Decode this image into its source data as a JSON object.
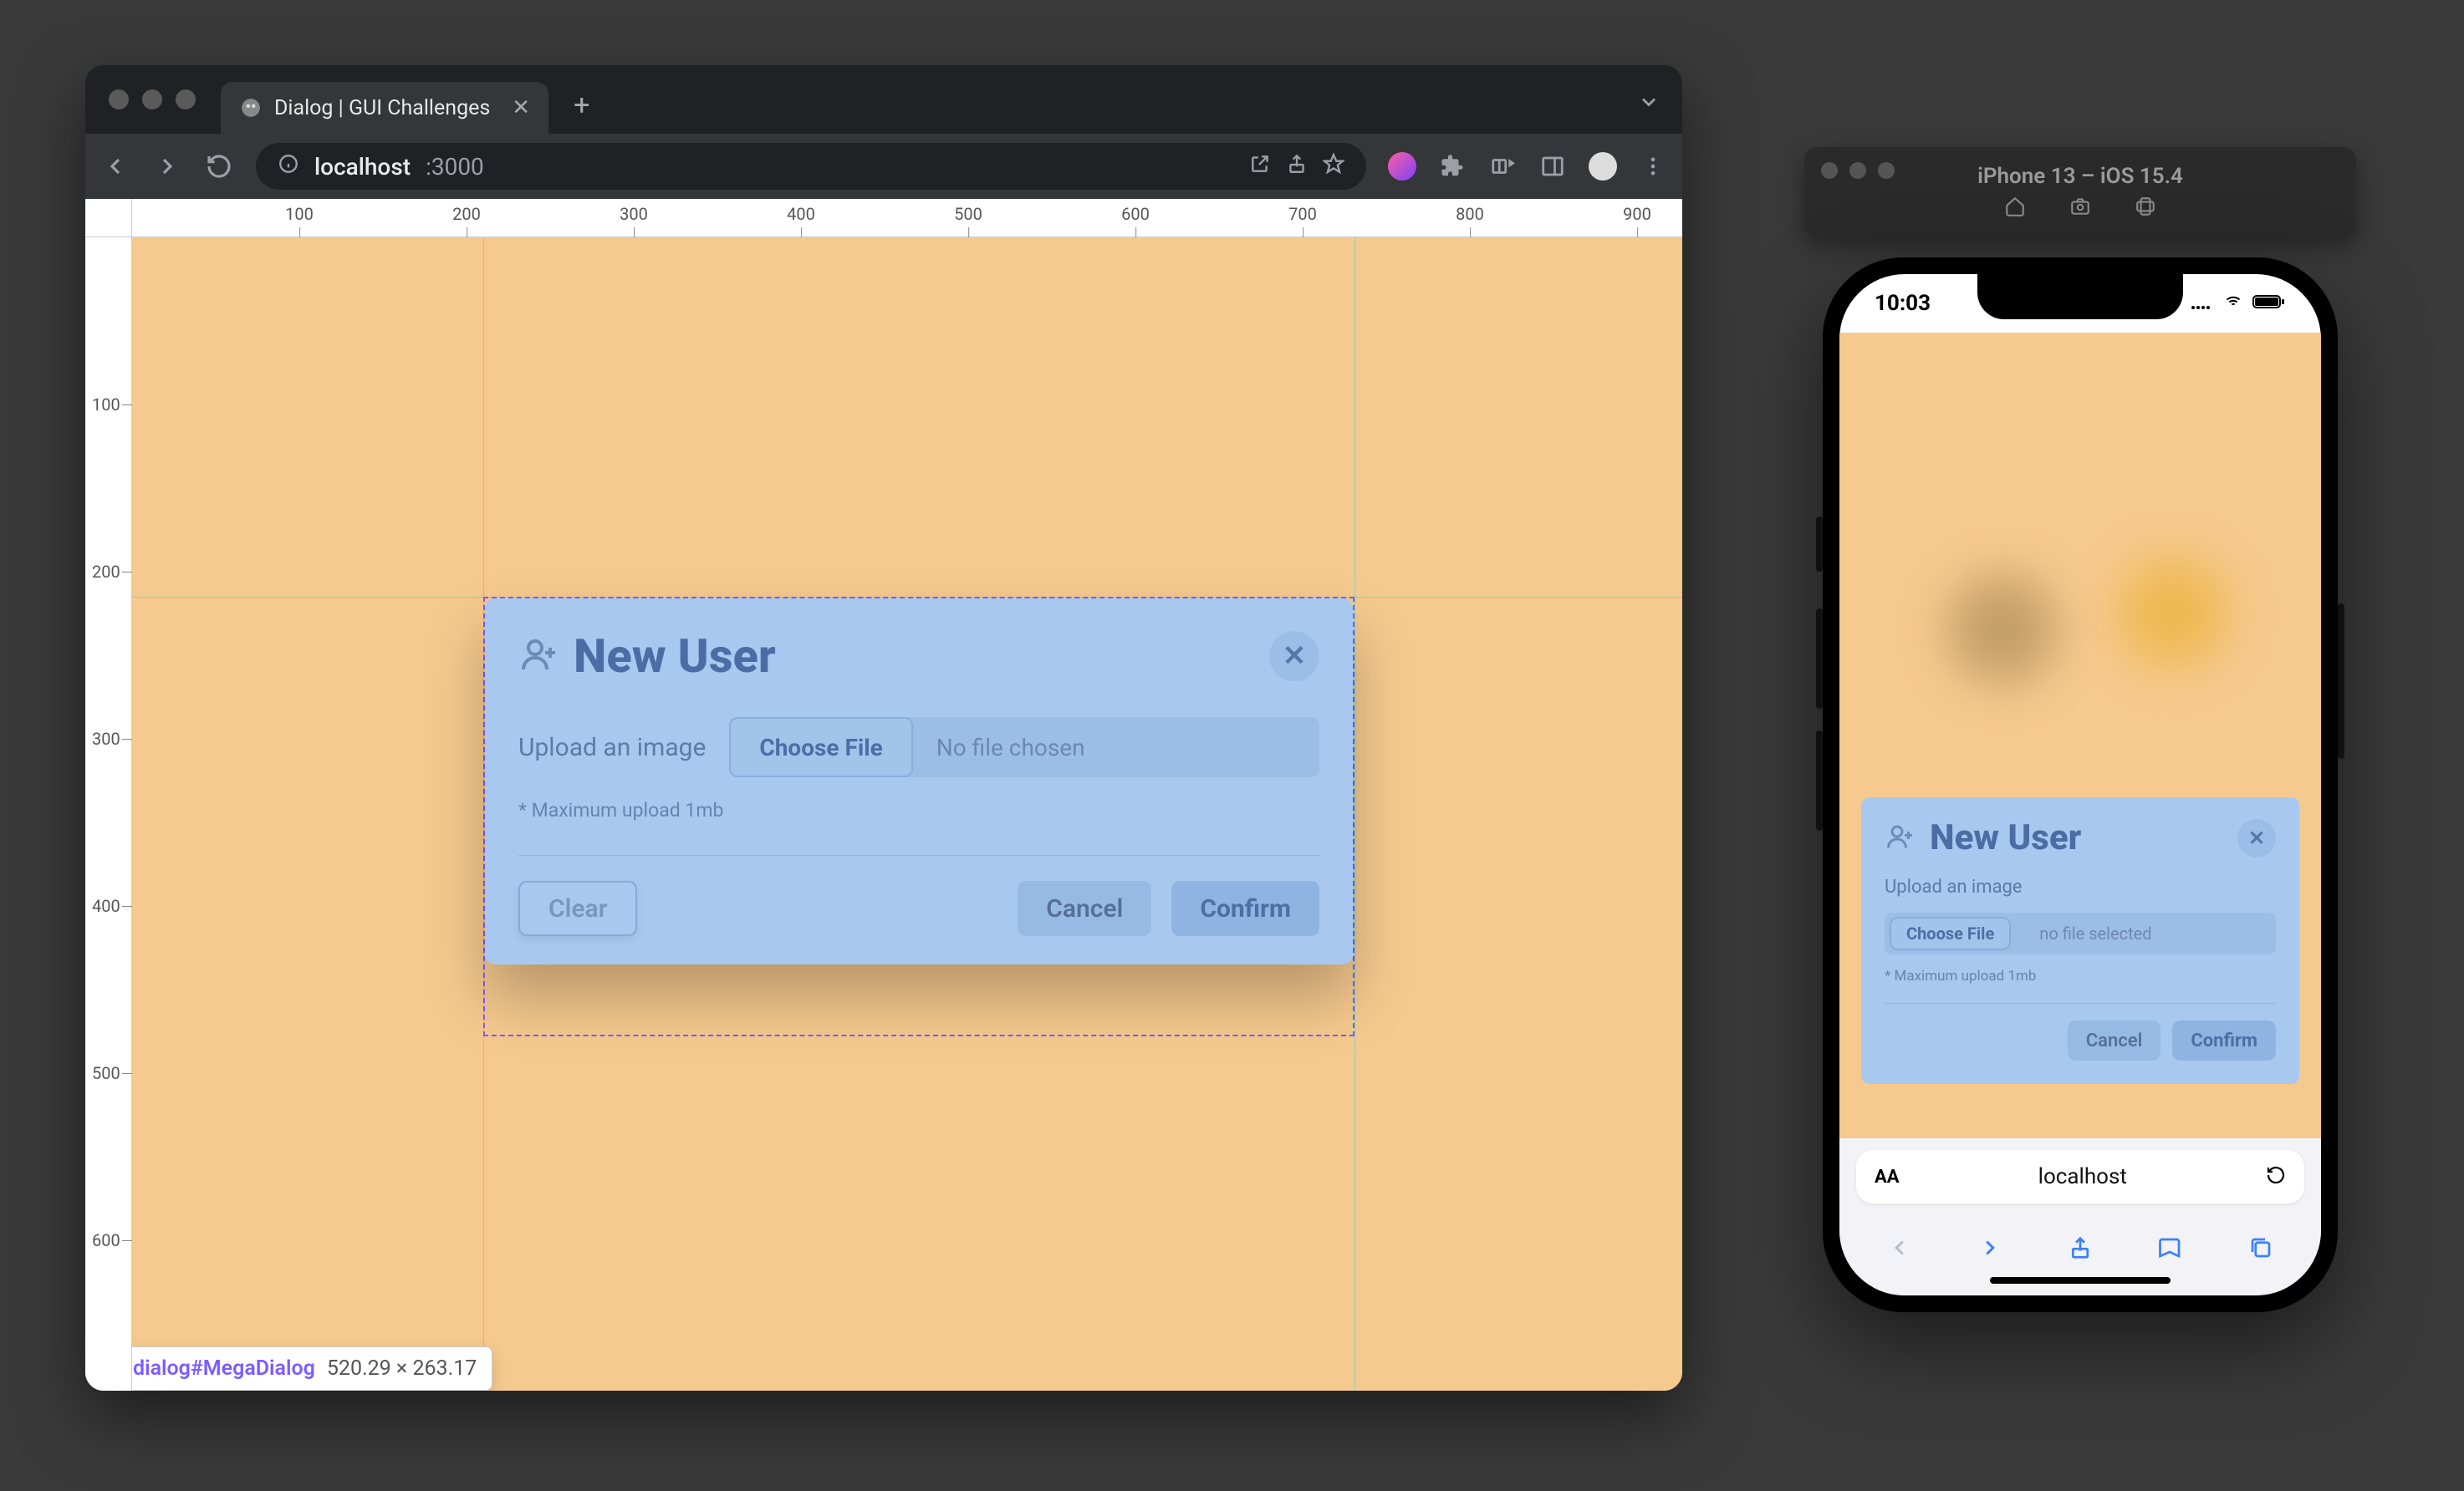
{
  "browser": {
    "tab": {
      "title": "Dialog | GUI Challenges"
    },
    "url": {
      "host": "localhost",
      "port": ":3000"
    }
  },
  "ruler": {
    "h": [
      "100",
      "200",
      "300",
      "400",
      "500",
      "600",
      "700",
      "800",
      "900"
    ],
    "v": [
      "100",
      "200",
      "300",
      "400",
      "500",
      "600"
    ]
  },
  "dialog": {
    "title": "New User",
    "upload_label": "Upload an image",
    "choose_file": "Choose File",
    "no_file": "No file chosen",
    "hint": "* Maximum upload 1mb",
    "clear": "Clear",
    "cancel": "Cancel",
    "confirm": "Confirm"
  },
  "devtools_tooltip": {
    "selector": "dialog#MegaDialog",
    "dims": "520.29 × 263.17"
  },
  "simulator": {
    "title": "iPhone 13 – iOS 15.4"
  },
  "iphone": {
    "time": "10:03",
    "safari_host": "localhost"
  },
  "mobile_dialog": {
    "title": "New User",
    "upload_label": "Upload an image",
    "choose_file": "Choose File",
    "no_file": "no file selected",
    "hint": "* Maximum upload 1mb",
    "cancel": "Cancel",
    "confirm": "Confirm"
  }
}
